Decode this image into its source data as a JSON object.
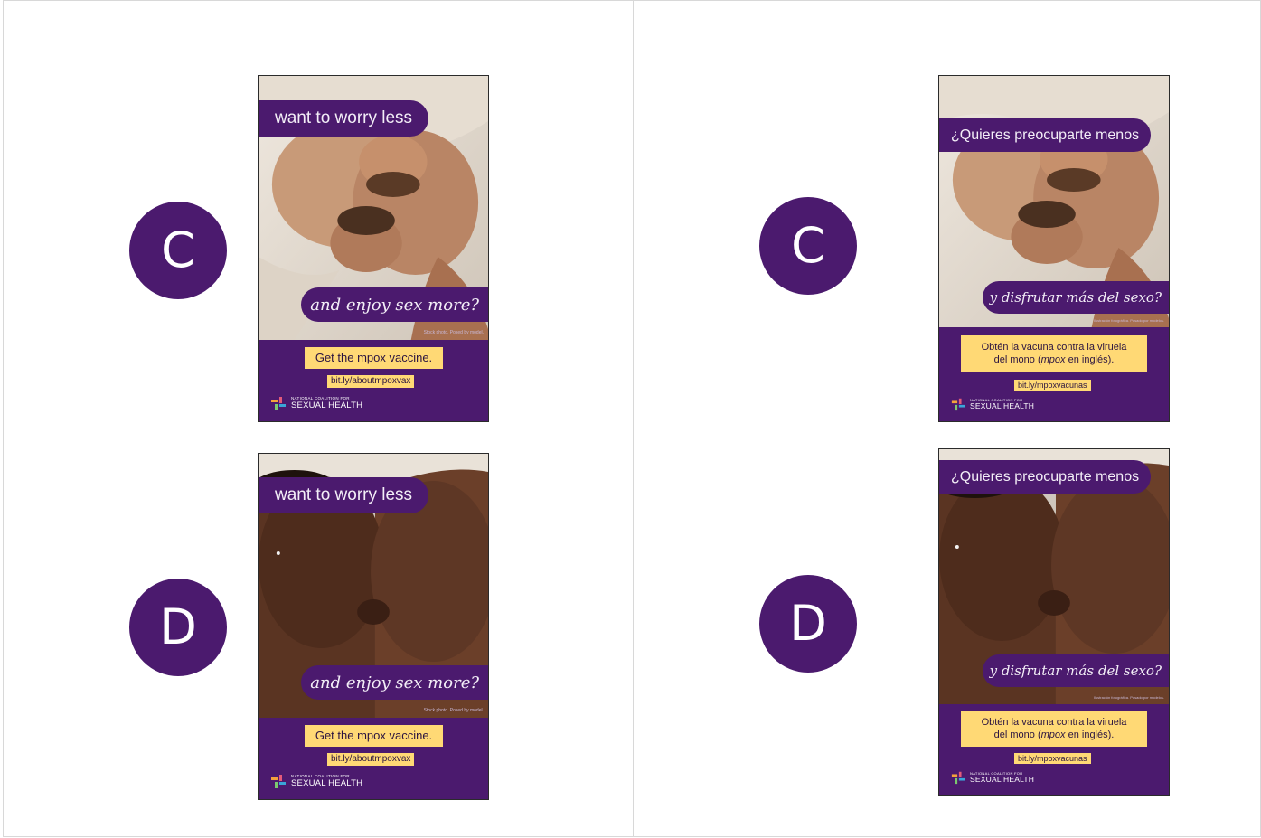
{
  "letters": {
    "c": "C",
    "d": "D"
  },
  "english": {
    "headline_top": "want to worry less",
    "headline_bottom": "and enjoy sex more?",
    "photo_credit": "Stock photo. Posed by model.",
    "cta": "Get the mpox vaccine.",
    "url": "bit.ly/aboutmpoxvax"
  },
  "spanish": {
    "headline_top": "¿Quieres preocuparte menos",
    "headline_bottom": "y disfrutar más del sexo?",
    "photo_credit": "Ilustración fotográfica. Posado por modelos.",
    "cta_line1": "Obtén la vacuna contra la viruela",
    "cta_line2_pre": "del mono (",
    "cta_line2_em": "mpox",
    "cta_line2_post": " en inglés).",
    "url": "bit.ly/mpoxvacunas"
  },
  "logo": {
    "small": "NATIONAL COALITION FOR",
    "big": "SEXUAL HEALTH"
  },
  "colors": {
    "brand_purple": "#4b1a6e",
    "highlight_yellow": "#ffd975"
  }
}
